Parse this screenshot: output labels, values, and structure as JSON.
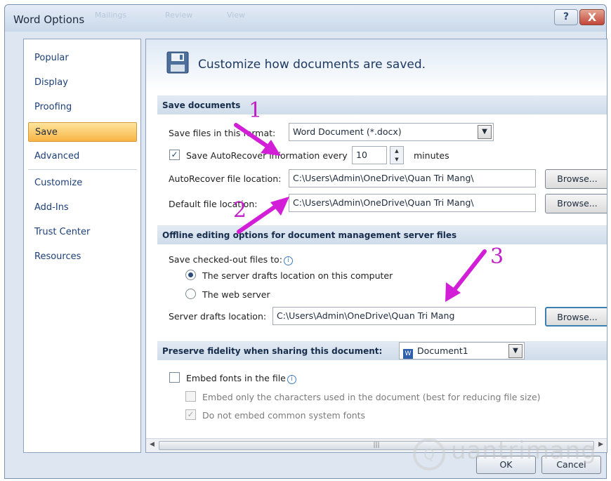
{
  "window": {
    "title": "Word Options",
    "ghost_tabs": [
      "Mailings",
      "Review",
      "View"
    ],
    "help_glyph": "?",
    "close_glyph": "X"
  },
  "sidebar": {
    "items": [
      {
        "label": "Popular"
      },
      {
        "label": "Display"
      },
      {
        "label": "Proofing"
      },
      {
        "label": "Save",
        "selected": true
      },
      {
        "label": "Advanced"
      },
      {
        "label": "Customize"
      },
      {
        "label": "Add-Ins"
      },
      {
        "label": "Trust Center"
      },
      {
        "label": "Resources"
      }
    ]
  },
  "header": {
    "title": "Customize how documents are saved.",
    "icon": "floppy-disk-icon"
  },
  "save_documents": {
    "heading": "Save documents",
    "format_label": "Save files in this format:",
    "format_value": "Word Document (*.docx)",
    "autorecover_label": "Save AutoRecover information every",
    "autorecover_checked": true,
    "autorecover_minutes": "10",
    "minutes_label": "minutes",
    "autorecover_location_label": "AutoRecover file location:",
    "autorecover_location_value": "C:\\Users\\Admin\\OneDrive\\Quan Tri Mang\\",
    "default_location_label": "Default file location:",
    "default_location_value": "C:\\Users\\Admin\\OneDrive\\Quan Tri Mang\\",
    "browse_label": "Browse..."
  },
  "offline_editing": {
    "heading": "Offline editing options for document management server files",
    "save_checked_out_label": "Save checked-out files to:",
    "option_server_drafts": "The server drafts location on this computer",
    "option_web_server": "The web server",
    "server_drafts_selected": true,
    "server_drafts_location_label": "Server drafts location:",
    "server_drafts_location_value": "C:\\Users\\Admin\\OneDrive\\Quan Tri Mang",
    "browse_label": "Browse..."
  },
  "fidelity": {
    "heading": "Preserve fidelity when sharing this document:",
    "document_value": "Document1",
    "embed_fonts_label": "Embed fonts in the file",
    "embed_fonts_checked": false,
    "embed_only_label": "Embed only the characters used in the document (best for reducing file size)",
    "no_common_fonts_label": "Do not embed common system fonts",
    "no_common_fonts_checked": true
  },
  "footer": {
    "ok_label": "OK",
    "cancel_label": "Cancel"
  },
  "annotations": {
    "n1": "1",
    "n2": "2",
    "n3": "3",
    "color": "#d21fd7"
  },
  "watermark": {
    "text": "uantrimang"
  }
}
